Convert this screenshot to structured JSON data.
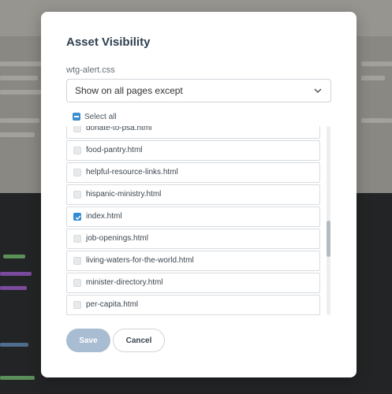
{
  "modal": {
    "title": "Asset Visibility",
    "file_name": "wtg-alert.css",
    "visibility_select": {
      "selected": "Show on all pages except"
    },
    "select_all_label": "Select all",
    "pages": [
      {
        "name": "donate-to-psa.html",
        "checked": false
      },
      {
        "name": "food-pantry.html",
        "checked": false
      },
      {
        "name": "helpful-resource-links.html",
        "checked": false
      },
      {
        "name": "hispanic-ministry.html",
        "checked": false
      },
      {
        "name": "index.html",
        "checked": true
      },
      {
        "name": "job-openings.html",
        "checked": false
      },
      {
        "name": "living-waters-for-the-world.html",
        "checked": false
      },
      {
        "name": "minister-directory.html",
        "checked": false
      },
      {
        "name": "per-capita.html",
        "checked": false
      }
    ],
    "buttons": {
      "save": "Save",
      "cancel": "Cancel"
    }
  },
  "colors": {
    "accent": "#2f8cd4",
    "save_disabled": "#a8bdd1",
    "title": "#2f3f4f"
  }
}
